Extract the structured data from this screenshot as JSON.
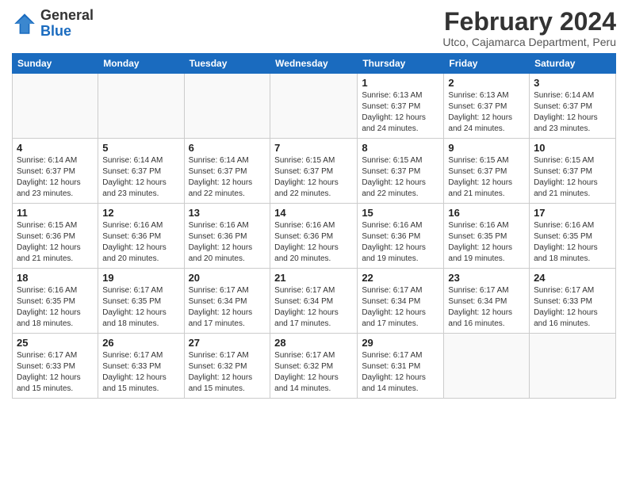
{
  "logo": {
    "general": "General",
    "blue": "Blue"
  },
  "title": "February 2024",
  "subtitle": "Utco, Cajamarca Department, Peru",
  "weekdays": [
    "Sunday",
    "Monday",
    "Tuesday",
    "Wednesday",
    "Thursday",
    "Friday",
    "Saturday"
  ],
  "weeks": [
    [
      {
        "day": "",
        "info": ""
      },
      {
        "day": "",
        "info": ""
      },
      {
        "day": "",
        "info": ""
      },
      {
        "day": "",
        "info": ""
      },
      {
        "day": "1",
        "info": "Sunrise: 6:13 AM\nSunset: 6:37 PM\nDaylight: 12 hours\nand 24 minutes."
      },
      {
        "day": "2",
        "info": "Sunrise: 6:13 AM\nSunset: 6:37 PM\nDaylight: 12 hours\nand 24 minutes."
      },
      {
        "day": "3",
        "info": "Sunrise: 6:14 AM\nSunset: 6:37 PM\nDaylight: 12 hours\nand 23 minutes."
      }
    ],
    [
      {
        "day": "4",
        "info": "Sunrise: 6:14 AM\nSunset: 6:37 PM\nDaylight: 12 hours\nand 23 minutes."
      },
      {
        "day": "5",
        "info": "Sunrise: 6:14 AM\nSunset: 6:37 PM\nDaylight: 12 hours\nand 23 minutes."
      },
      {
        "day": "6",
        "info": "Sunrise: 6:14 AM\nSunset: 6:37 PM\nDaylight: 12 hours\nand 22 minutes."
      },
      {
        "day": "7",
        "info": "Sunrise: 6:15 AM\nSunset: 6:37 PM\nDaylight: 12 hours\nand 22 minutes."
      },
      {
        "day": "8",
        "info": "Sunrise: 6:15 AM\nSunset: 6:37 PM\nDaylight: 12 hours\nand 22 minutes."
      },
      {
        "day": "9",
        "info": "Sunrise: 6:15 AM\nSunset: 6:37 PM\nDaylight: 12 hours\nand 21 minutes."
      },
      {
        "day": "10",
        "info": "Sunrise: 6:15 AM\nSunset: 6:37 PM\nDaylight: 12 hours\nand 21 minutes."
      }
    ],
    [
      {
        "day": "11",
        "info": "Sunrise: 6:15 AM\nSunset: 6:36 PM\nDaylight: 12 hours\nand 21 minutes."
      },
      {
        "day": "12",
        "info": "Sunrise: 6:16 AM\nSunset: 6:36 PM\nDaylight: 12 hours\nand 20 minutes."
      },
      {
        "day": "13",
        "info": "Sunrise: 6:16 AM\nSunset: 6:36 PM\nDaylight: 12 hours\nand 20 minutes."
      },
      {
        "day": "14",
        "info": "Sunrise: 6:16 AM\nSunset: 6:36 PM\nDaylight: 12 hours\nand 20 minutes."
      },
      {
        "day": "15",
        "info": "Sunrise: 6:16 AM\nSunset: 6:36 PM\nDaylight: 12 hours\nand 19 minutes."
      },
      {
        "day": "16",
        "info": "Sunrise: 6:16 AM\nSunset: 6:35 PM\nDaylight: 12 hours\nand 19 minutes."
      },
      {
        "day": "17",
        "info": "Sunrise: 6:16 AM\nSunset: 6:35 PM\nDaylight: 12 hours\nand 18 minutes."
      }
    ],
    [
      {
        "day": "18",
        "info": "Sunrise: 6:16 AM\nSunset: 6:35 PM\nDaylight: 12 hours\nand 18 minutes."
      },
      {
        "day": "19",
        "info": "Sunrise: 6:17 AM\nSunset: 6:35 PM\nDaylight: 12 hours\nand 18 minutes."
      },
      {
        "day": "20",
        "info": "Sunrise: 6:17 AM\nSunset: 6:34 PM\nDaylight: 12 hours\nand 17 minutes."
      },
      {
        "day": "21",
        "info": "Sunrise: 6:17 AM\nSunset: 6:34 PM\nDaylight: 12 hours\nand 17 minutes."
      },
      {
        "day": "22",
        "info": "Sunrise: 6:17 AM\nSunset: 6:34 PM\nDaylight: 12 hours\nand 17 minutes."
      },
      {
        "day": "23",
        "info": "Sunrise: 6:17 AM\nSunset: 6:34 PM\nDaylight: 12 hours\nand 16 minutes."
      },
      {
        "day": "24",
        "info": "Sunrise: 6:17 AM\nSunset: 6:33 PM\nDaylight: 12 hours\nand 16 minutes."
      }
    ],
    [
      {
        "day": "25",
        "info": "Sunrise: 6:17 AM\nSunset: 6:33 PM\nDaylight: 12 hours\nand 15 minutes."
      },
      {
        "day": "26",
        "info": "Sunrise: 6:17 AM\nSunset: 6:33 PM\nDaylight: 12 hours\nand 15 minutes."
      },
      {
        "day": "27",
        "info": "Sunrise: 6:17 AM\nSunset: 6:32 PM\nDaylight: 12 hours\nand 15 minutes."
      },
      {
        "day": "28",
        "info": "Sunrise: 6:17 AM\nSunset: 6:32 PM\nDaylight: 12 hours\nand 14 minutes."
      },
      {
        "day": "29",
        "info": "Sunrise: 6:17 AM\nSunset: 6:31 PM\nDaylight: 12 hours\nand 14 minutes."
      },
      {
        "day": "",
        "info": ""
      },
      {
        "day": "",
        "info": ""
      }
    ]
  ]
}
